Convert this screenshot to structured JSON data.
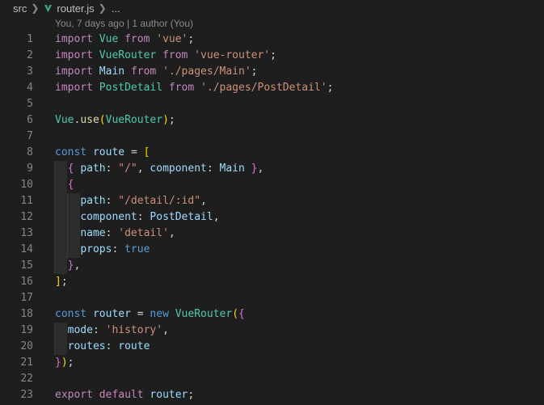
{
  "breadcrumb": {
    "folder": "src",
    "file": "router.js",
    "more": "..."
  },
  "blame": "You, 7 days ago | 1 author (You)",
  "icons": {
    "separator": "chevron-right-icon",
    "file_icon": "vue-icon",
    "file_icon_color": "#41b883"
  },
  "lines": [
    {
      "n": "1"
    },
    {
      "n": "2"
    },
    {
      "n": "3"
    },
    {
      "n": "4"
    },
    {
      "n": "5"
    },
    {
      "n": "6"
    },
    {
      "n": "7"
    },
    {
      "n": "8"
    },
    {
      "n": "9"
    },
    {
      "n": "10"
    },
    {
      "n": "11"
    },
    {
      "n": "12"
    },
    {
      "n": "13"
    },
    {
      "n": "14"
    },
    {
      "n": "15"
    },
    {
      "n": "16"
    },
    {
      "n": "17"
    },
    {
      "n": "18"
    },
    {
      "n": "19"
    },
    {
      "n": "20"
    },
    {
      "n": "21"
    },
    {
      "n": "22"
    },
    {
      "n": "23"
    }
  ],
  "code": {
    "l1": {
      "import": "import",
      "name": "Vue",
      "from": "from",
      "src": "'vue'",
      "end": ";"
    },
    "l2": {
      "import": "import",
      "name": "VueRouter",
      "from": "from",
      "src": "'vue-router'",
      "end": ";"
    },
    "l3": {
      "import": "import",
      "name": "Main",
      "from": "from",
      "src": "'./pages/Main'",
      "end": ";"
    },
    "l4": {
      "import": "import",
      "name": "PostDetail",
      "from": "from",
      "src": "'./pages/PostDetail'",
      "end": ";"
    },
    "l6": {
      "obj": "Vue",
      "dot": ".",
      "fn": "use",
      "open": "(",
      "arg": "VueRouter",
      "close": ")",
      "end": ";"
    },
    "l8": {
      "kw": "const",
      "name": "route",
      "eq": "=",
      "open": "["
    },
    "l9": {
      "open": "{",
      "k1": "path",
      "colon1": ":",
      "v1": "\"/\"",
      "comma1": ",",
      "k2": "component",
      "colon2": ":",
      "v2": "Main",
      "close": "}",
      "comma2": ","
    },
    "l10": {
      "open": "{"
    },
    "l11": {
      "k": "path",
      "colon": ":",
      "v": "\"/detail/:id\"",
      "comma": ","
    },
    "l12": {
      "k": "component",
      "colon": ":",
      "v": "PostDetail",
      "comma": ","
    },
    "l13": {
      "k": "name",
      "colon": ":",
      "v": "'detail'",
      "comma": ","
    },
    "l14": {
      "k": "props",
      "colon": ":",
      "v": "true"
    },
    "l15": {
      "close": "}",
      "comma": ","
    },
    "l16": {
      "close": "]",
      "end": ";"
    },
    "l18": {
      "kw": "const",
      "name": "router",
      "eq": "=",
      "new": "new",
      "cls": "VueRouter",
      "open1": "(",
      "open2": "{"
    },
    "l19": {
      "k": "mode",
      "colon": ":",
      "v": "'history'",
      "comma": ","
    },
    "l20": {
      "k": "routes",
      "colon": ":",
      "v": "route"
    },
    "l21": {
      "close2": "}",
      "close1": ")",
      "end": ";"
    },
    "l23": {
      "export": "export",
      "def": "default",
      "name": "router",
      "end": ";"
    }
  }
}
